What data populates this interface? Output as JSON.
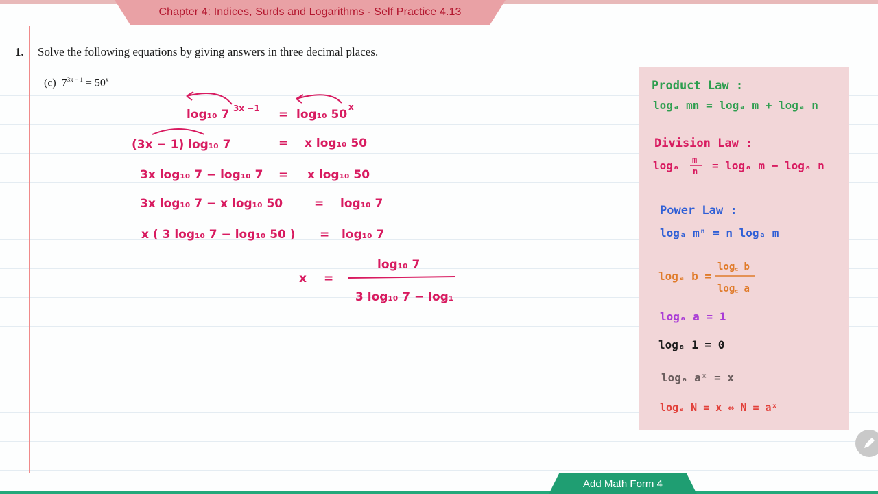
{
  "header": {
    "title": "Chapter 4: Indices, Surds and Logarithms - Self Practice 4.13"
  },
  "question": {
    "number": "1.",
    "text": "Solve the following equations by giving answers in three decimal places.",
    "part_label": "(c)",
    "equation_base_left": "7",
    "equation_exp_left": "3x − 1",
    "equation_equals": " = ",
    "equation_base_right": "50",
    "equation_exp_right": "x"
  },
  "handwritten_work": {
    "line1_left": "log₁₀ 7",
    "line1_left_exp": "3x −1",
    "line1_eq": "=",
    "line1_right": "log₁₀ 50",
    "line1_right_exp": "x",
    "line2_left": "(3x − 1)  log₁₀ 7",
    "line2_eq": "=",
    "line2_right": "x  log₁₀ 50",
    "line3_left": "3x log₁₀ 7  −  log₁₀ 7",
    "line3_eq": "=",
    "line3_right": "x  log₁₀ 50",
    "line4_left": "3x log₁₀ 7  −  x log₁₀ 50",
    "line4_eq": "=",
    "line4_right": "log₁₀ 7",
    "line5_left": "x ( 3 log₁₀ 7  −  log₁₀ 50 )",
    "line5_eq": "=",
    "line5_right": "log₁₀ 7",
    "line6_lhs": "x",
    "line6_eq": "=",
    "line6_num": "log₁₀ 7",
    "line6_den": "3 log₁₀ 7 − log₁"
  },
  "laws_panel": {
    "product_title": "Product Law :",
    "product_rule": "logₐ mn  =  logₐ m  +  logₐ n",
    "division_title": "Division Law :",
    "division_lhs": "logₐ",
    "division_frac_num": "m",
    "division_frac_den": "n",
    "division_rhs": "=  logₐ m  −  logₐ n",
    "power_title": "Power Law :",
    "power_rule": "logₐ mⁿ  =  n logₐ m",
    "change_base_lhs": "logₐ b  =",
    "change_base_num": "log꜀ b",
    "change_base_den": "log꜀ a",
    "identity1": "logₐ a  =  1",
    "identity2": "logₐ 1  =  0",
    "identity3": "logₐ aˣ = x",
    "identity4": "logₐ N = x ⇔ N = aˣ",
    "colors": {
      "product": "#2e9e4f",
      "division": "#d81b60",
      "power": "#2f5fd6",
      "change_base": "#e07b2a",
      "identity1": "#a93bd6",
      "identity2": "#1c1c1c",
      "identity3": "#6a5d5d",
      "identity4": "#e2403a"
    }
  },
  "footer": {
    "label": "Add Math Form 4"
  },
  "controls": {
    "pencil": "pencil-icon"
  }
}
